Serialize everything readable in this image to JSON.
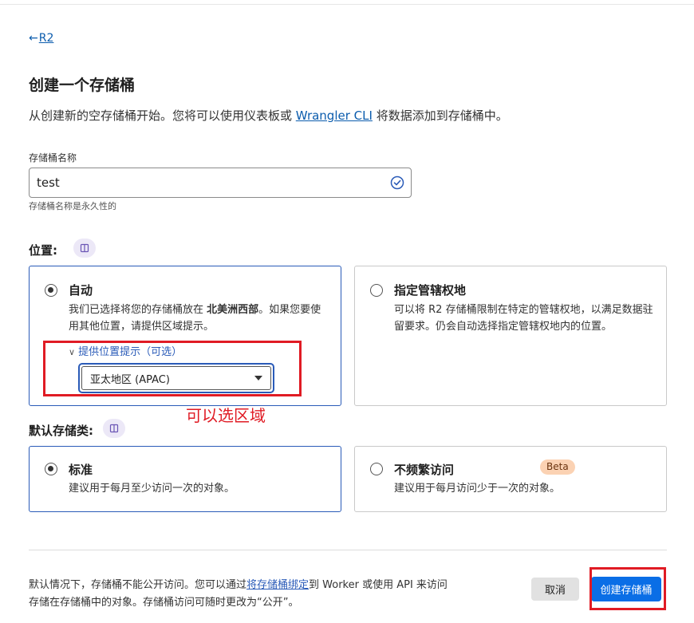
{
  "breadcrumb": {
    "back_arrow": "←",
    "back_label": "R2"
  },
  "page": {
    "title": "创建一个存储桶",
    "intro_before": "从创建新的空存储桶开始。您将可以使用仪表板或 ",
    "intro_link": "Wrangler CLI",
    "intro_after": " 将数据添加到存储桶中。"
  },
  "bucket_name": {
    "label": "存储桶名称",
    "value": "test",
    "hint": "存储桶名称是永久性的",
    "valid_icon": "check-circle-icon"
  },
  "location": {
    "label": "位置:",
    "doc_icon": "book-icon",
    "options": [
      {
        "title": "自动",
        "desc_before": "我们已选择将您的存储桶放在 ",
        "desc_bold": "北美洲西部",
        "desc_after": "。如果您要使用其他位置，请提供区域提示。",
        "selected": true
      },
      {
        "title": "指定管辖权地",
        "desc": "可以将 R2 存储桶限制在特定的管辖权地，以满足数据驻留要求。仍会自动选择指定管辖权地内的位置。",
        "selected": false
      }
    ],
    "hint_toggle_icon": "chevron-down-icon",
    "hint_toggle": "提供位置提示（可选）",
    "hint_select_value": "亚太地区 (APAC)"
  },
  "annotation": "可以选区域",
  "storage_class": {
    "label": "默认存储类:",
    "doc_icon": "book-icon",
    "options": [
      {
        "title": "标准",
        "desc": "建议用于每月至少访问一次的对象。",
        "selected": true
      },
      {
        "title": "不频繁访问",
        "badge": "Beta",
        "desc": "建议用于每月访问少于一次的对象。",
        "selected": false
      }
    ]
  },
  "footer": {
    "text_before": "默认情况下，存储桶不能公开访问。您可以通过",
    "text_link": "将存储桶绑定",
    "text_after": "到 Worker 或使用 API 来访问存储在存储桶中的对象。存储桶访问可随时更改为“公开”。",
    "cancel_label": "取消",
    "create_label": "创建存储桶"
  },
  "colors": {
    "accent": "#0a6ee6",
    "link": "#0b5cad",
    "annotation": "#e01b24",
    "beta_bg": "#fbd2b3"
  }
}
